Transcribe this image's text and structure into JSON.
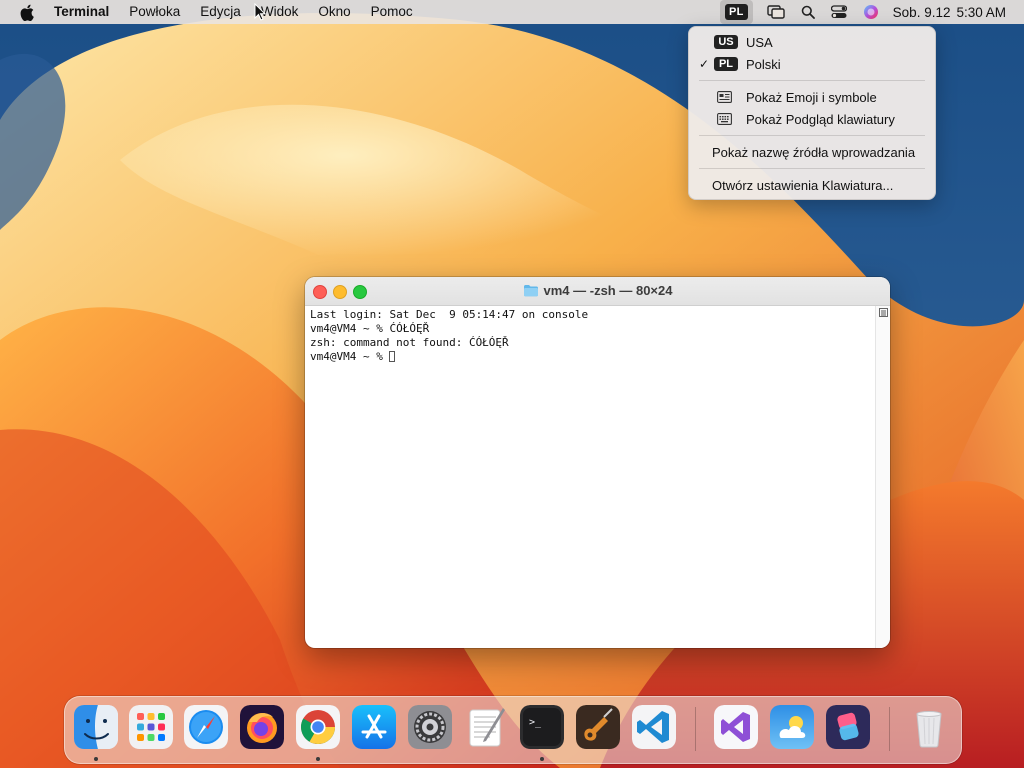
{
  "menubar": {
    "app_name": "Terminal",
    "menus": [
      "Powłoka",
      "Edycja",
      "Widok",
      "Okno",
      "Pomoc"
    ],
    "input_source_badge": "PL",
    "clock_date": "Sob. 9.12",
    "clock_time": "5:30 AM"
  },
  "input_menu": {
    "languages": [
      {
        "code": "US",
        "label": "USA",
        "checked": false
      },
      {
        "code": "PL",
        "label": "Polski",
        "checked": true
      }
    ],
    "check_mark": "✓",
    "show_emoji": "Pokaż Emoji i symbole",
    "show_keyboard_viewer": "Pokaż Podgląd klawiatury",
    "show_input_source_name": "Pokaż nazwę źródła wprowadzania",
    "open_keyboard_settings": "Otwórz ustawienia Klawiatura..."
  },
  "terminal": {
    "title": "vm4 — -zsh — 80×24",
    "lines": [
      "Last login: Sat Dec  9 05:14:47 on console",
      "vm4@VM4 ~ % ĆÓŁÓĘŘ",
      "zsh: command not found: ĆÓŁÓĘŘ",
      "vm4@VM4 ~ % "
    ]
  },
  "dock": {
    "apps": [
      "finder-icon",
      "launchpad-icon",
      "safari-icon",
      "firefox-icon",
      "chrome-icon",
      "app-store-icon",
      "system-settings-icon",
      "textedit-icon",
      "terminal-icon",
      "garageband-icon",
      "vscode-icon",
      "visual-studio-icon",
      "weather-icon",
      "shortcuts-icon",
      "trash-icon"
    ],
    "running": [
      "finder-icon",
      "chrome-icon",
      "terminal-icon"
    ]
  },
  "colors": {
    "menubar_bg": "#eae4de",
    "traffic_close": "#fe5f57",
    "traffic_min": "#febc2e",
    "traffic_max": "#28c840"
  }
}
